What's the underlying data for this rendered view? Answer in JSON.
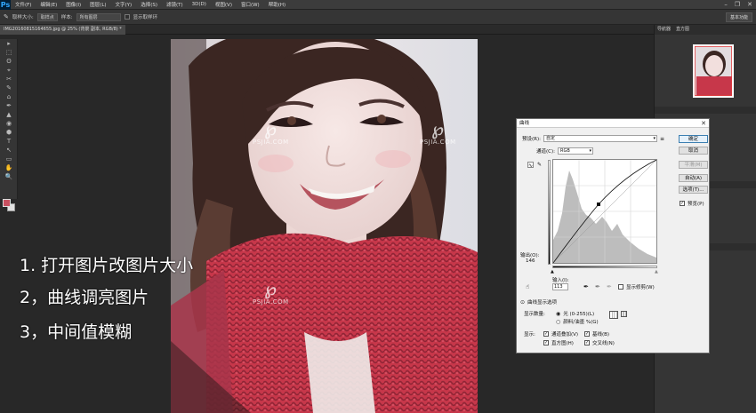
{
  "app": {
    "logo": "Ps"
  },
  "menu": [
    "文件(F)",
    "编辑(E)",
    "图像(I)",
    "图层(L)",
    "文字(Y)",
    "选择(S)",
    "滤镜(T)",
    "3D(D)",
    "视图(V)",
    "窗口(W)",
    "帮助(H)"
  ],
  "window_controls": [
    "–",
    "❐",
    "✕"
  ],
  "options_bar": {
    "sample_size_label": "取样大小:",
    "sample_size_value": "取样点",
    "sample_label": "样本:",
    "sample_value": "所有图层",
    "show_ring_label": "显示取样环",
    "workspace": "基本功能"
  },
  "document_tab": {
    "title": "IMG20160815164655.jpg @ 25% (背景 副本, RGB/8) *"
  },
  "overlay_text": [
    "1. 打开图片改图片大小",
    "2，曲线调亮图片",
    "3，中间值模糊"
  ],
  "watermark_text": "PSJIA.COM",
  "watermark_logo": "℘",
  "right_panel": {
    "tabs": [
      "导航器",
      "直方图"
    ],
    "layers_label": "图层"
  },
  "curves_dialog": {
    "title": "曲线",
    "close": "✕",
    "preset_label": "预设(R):",
    "preset_value": "自定",
    "channel_label": "通道(C):",
    "channel_value": "RGB",
    "buttons": {
      "ok": "确定",
      "cancel": "取消",
      "smooth": "平滑(M)",
      "auto": "自动(A)",
      "options": "选项(T)..."
    },
    "preview_label": "预览(P)",
    "preview_checked": true,
    "output_label": "输出(O):",
    "output_value": "146",
    "input_label": "输入(I):",
    "input_value": "113",
    "show_clipping_label": "显示修剪(W)",
    "display_options_label": "曲线显示选项",
    "show_amount_label": "显示数量:",
    "light_label": "光 (0-255)(L)",
    "pigment_label": "颜料/油墨 %(G)",
    "show_label": "显示:",
    "channel_overlays_label": "通道叠加(V)",
    "baseline_label": "基线(B)",
    "histogram_label": "直方图(H)",
    "intersection_label": "交叉线(N)"
  },
  "tools": [
    "▸",
    "⬚",
    "ʘ",
    "⌖",
    "✂",
    "✎",
    "⌂",
    "✒",
    "▲",
    "◉",
    "⬢",
    "T",
    "↖",
    "▭",
    "✋",
    "🔍"
  ]
}
